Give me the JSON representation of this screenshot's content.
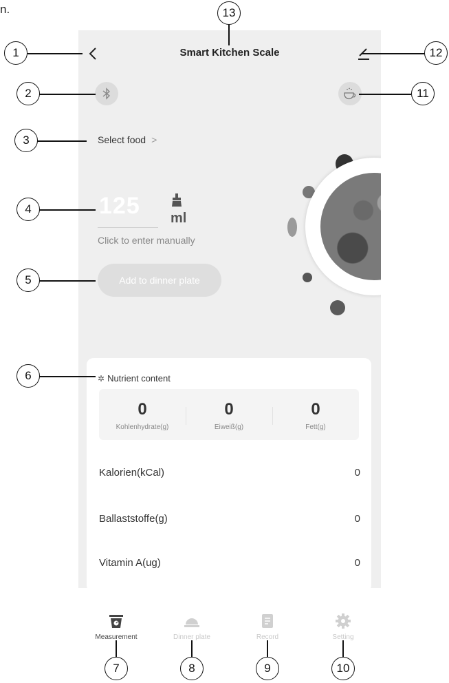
{
  "corner_text": "n.",
  "header": {
    "title": "Smart Kitchen Scale"
  },
  "select_food": {
    "label": "Select food",
    "chevron": ">"
  },
  "weight": {
    "value": "125",
    "unit": "ml",
    "hint": "Click to enter manually"
  },
  "add_button": {
    "label": "Add to dinner plate"
  },
  "nutrients": {
    "title": "Nutrient content",
    "macros": [
      {
        "value": "0",
        "label": "Kohlenhydrate(g)"
      },
      {
        "value": "0",
        "label": "Eiweiß(g)"
      },
      {
        "value": "0",
        "label": "Fett(g)"
      }
    ],
    "rows": [
      {
        "label": "Kalorien(kCal)",
        "value": "0"
      },
      {
        "label": "Ballaststoffe(g)",
        "value": "0"
      },
      {
        "label": "Vitamin A(ug)",
        "value": "0"
      }
    ]
  },
  "tabs": [
    {
      "label": "Measurement",
      "icon": "scale-icon",
      "active": true
    },
    {
      "label": "Dinner plate",
      "icon": "dinner-plate-icon",
      "active": false
    },
    {
      "label": "Record",
      "icon": "record-icon",
      "active": false
    },
    {
      "label": "Setting",
      "icon": "gear-icon",
      "active": false
    }
  ],
  "callouts": [
    "1",
    "2",
    "3",
    "4",
    "5",
    "6",
    "7",
    "8",
    "9",
    "10",
    "11",
    "12",
    "13"
  ],
  "colors": {
    "background": "#efefef",
    "inactive": "#c9c9c9",
    "active": "#444444"
  }
}
